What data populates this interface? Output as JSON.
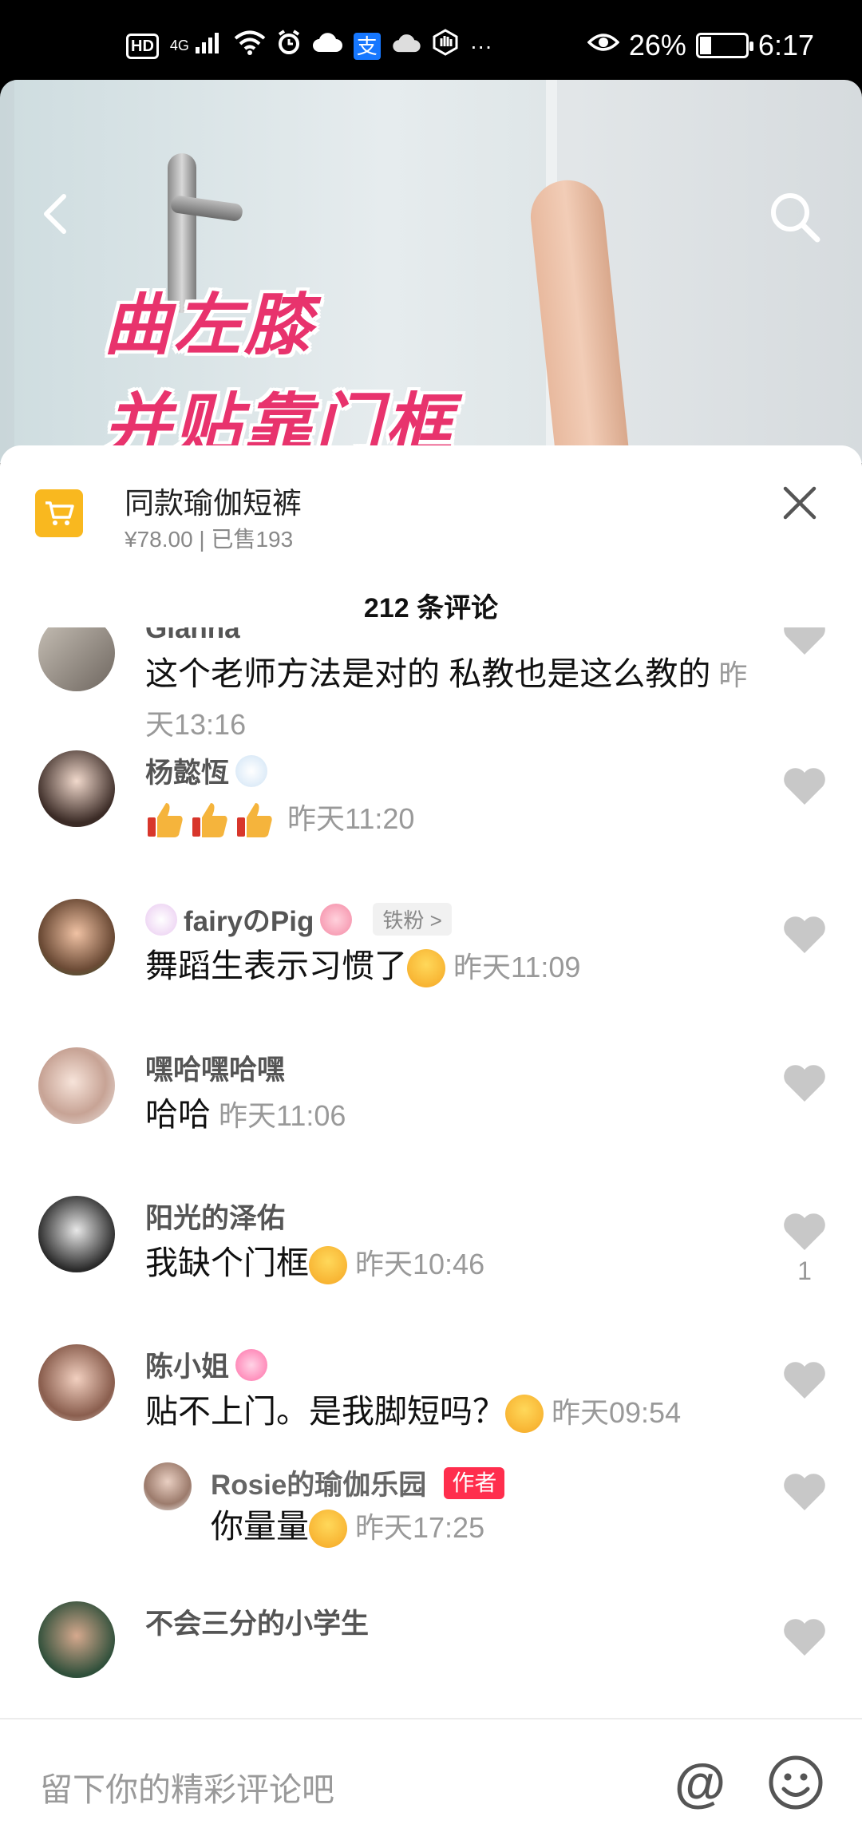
{
  "status_bar": {
    "left_icons": [
      "hd-icon",
      "4g-signal-icon",
      "wifi-icon",
      "alarm-icon",
      "cloud-icon",
      "alipay-icon",
      "cloud-icon",
      "gesture-icon",
      "more-icon"
    ],
    "hd": "HD",
    "net": "4G",
    "alipay": "支",
    "more": "···",
    "battery_percent": "26%",
    "battery_level": 0.26,
    "time": "6:17"
  },
  "video": {
    "caption_line1": "曲左膝",
    "caption_line2": "并贴靠门框"
  },
  "product": {
    "name": "同款瑜伽短裤",
    "meta": "¥78.00 | 已售193"
  },
  "comment_count": "212 条评论",
  "comments": [
    {
      "name": "Gianna",
      "text": "这个老师方法是对的 私教也是这么教的",
      "time": "昨天13:16",
      "likes": ""
    },
    {
      "name": "杨懿恆",
      "text": "",
      "time": "昨天11:20",
      "likes": ""
    },
    {
      "name": "fairyのPig",
      "badge": "铁粉 >",
      "text": "舞蹈生表示习惯了",
      "time": "昨天11:09",
      "likes": ""
    },
    {
      "name": "嘿哈嘿哈嘿",
      "text": "哈哈",
      "time": "昨天11:06",
      "likes": ""
    },
    {
      "name": "阳光的泽佑",
      "text": "我缺个门框",
      "time": "昨天10:46",
      "likes": "1"
    },
    {
      "name": "陈小姐",
      "text": "贴不上门。是我脚短吗？",
      "time": "昨天09:54",
      "likes": ""
    },
    {
      "name": "Rosie的瑜伽乐园",
      "badge": "作者",
      "text": "你量量",
      "time": "昨天17:25",
      "likes": ""
    },
    {
      "name": "不会三分的小学生",
      "text": "",
      "time": "",
      "likes": ""
    }
  ],
  "input": {
    "placeholder": "留下你的精彩评论吧",
    "at": "@"
  },
  "colors": {
    "accent_red": "#ff2e4d",
    "cart_yellow": "#f9b81f",
    "caption_pink": "#e8336d"
  }
}
